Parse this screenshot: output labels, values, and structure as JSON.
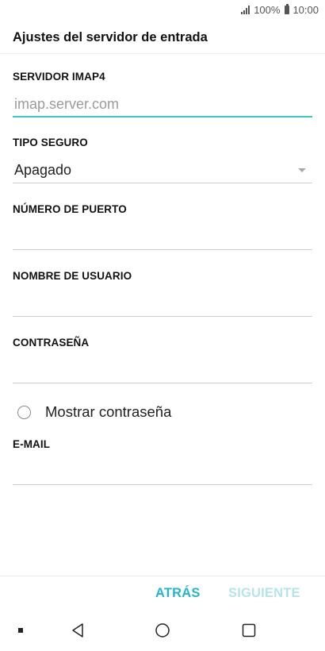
{
  "status_bar": {
    "battery": "100%",
    "time": "10:00"
  },
  "header": {
    "title": "Ajustes del servidor de entrada"
  },
  "form": {
    "server": {
      "label": "SERVIDOR IMAP4",
      "placeholder": "imap.server.com",
      "value": ""
    },
    "security": {
      "label": "TIPO SEGURO",
      "value": "Apagado"
    },
    "port": {
      "label": "NÚMERO DE PUERTO",
      "value": ""
    },
    "username": {
      "label": "NOMBRE DE USUARIO",
      "value": ""
    },
    "password": {
      "label": "CONTRASEÑA",
      "value": ""
    },
    "show_password": {
      "label": "Mostrar contraseña",
      "checked": false
    },
    "email": {
      "label": "E-MAIL",
      "value": ""
    }
  },
  "actions": {
    "back_label": "ATRÁS",
    "next_label": "SIGUIENTE",
    "next_enabled": false
  },
  "colors": {
    "accent": "#24b6c8",
    "accent_disabled": "#b6e4ea",
    "active_underline": "#3cc6c6"
  },
  "nav": {
    "icons": [
      "dot-icon",
      "back-triangle-icon",
      "home-circle-icon",
      "recents-square-icon"
    ]
  }
}
